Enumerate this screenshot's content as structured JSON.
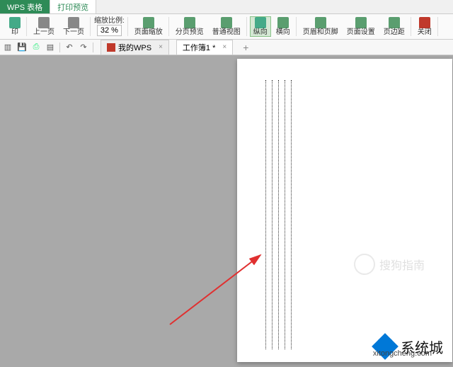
{
  "tabs": {
    "app": "WPS 表格",
    "active": "打印预览"
  },
  "ribbon": {
    "print": "印",
    "prev_page": "上一页",
    "next_page": "下一页",
    "zoom_label": "缩放比例:",
    "zoom_value": "32 %",
    "page_zoom": "页面缩放",
    "page_break": "分页预览",
    "normal_view": "普通视图",
    "portrait": "纵向",
    "landscape": "横向",
    "header_footer": "页眉和页脚",
    "page_setup": "页面设置",
    "margins": "页边距",
    "close": "关闭"
  },
  "qat": {
    "undo": "↶",
    "redo": "↷"
  },
  "docTabs": {
    "tab1": "我的WPS",
    "tab2": "工作簿1 *",
    "close": "×",
    "add": "+"
  },
  "watermark": {
    "top": "搜狗指南",
    "bottom_main": "系统城",
    "bottom_sub": "xitongcheng.com"
  }
}
